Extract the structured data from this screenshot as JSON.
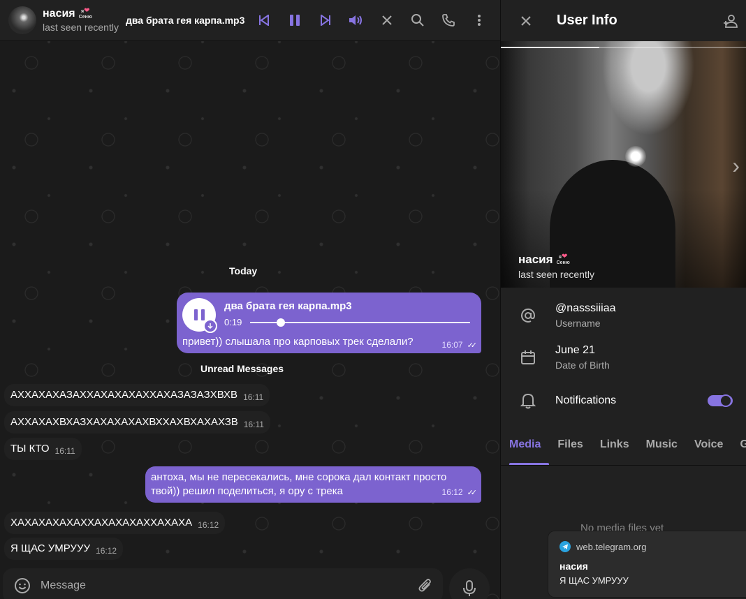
{
  "header": {
    "name": "насия",
    "sticker_line1": "я",
    "sticker_line2": "Сеню",
    "status": "last seen recently",
    "track_title": "два брата гея карпа.mp3"
  },
  "chat": {
    "date_label": "Today",
    "unread_label": "Unread Messages",
    "audio_message": {
      "title": "два брата гея карпа.mp3",
      "duration": "0:19",
      "progress": 0.14,
      "caption": "привет)) слышала про карповых трек сделали?",
      "time": "16:07"
    },
    "messages": [
      {
        "dir": "in",
        "text": "АХХАХАХАЗАХХАХАХАХАХХАХАЗАЗАЗХВХВ",
        "time": "16:11"
      },
      {
        "dir": "in",
        "text": "АХХАХАХВХАЗХАХАХАХАХВХХАХВХАХАХЗВ",
        "time": "16:11"
      },
      {
        "dir": "in",
        "text": "ТЫ КТО",
        "time": "16:11"
      },
      {
        "dir": "out",
        "text_line1": "антоха, мы не пересекались, мне сорока дал контакт просто",
        "text_line2": "твой)) решил поделиться, я ору с трека",
        "time": "16:12"
      },
      {
        "dir": "in",
        "text": "ХАХАХАХАХАХХАХАХАХАХХАХАХА",
        "time": "16:12"
      },
      {
        "dir": "in",
        "text": "Я ЩАС УМРУУУ",
        "time": "16:12"
      }
    ],
    "composer_placeholder": "Message"
  },
  "user_info": {
    "title": "User Info",
    "name": "насия",
    "sticker_line1": "я",
    "sticker_line2": "Сеню",
    "status": "last seen recently",
    "username": "@nasssiiiaa",
    "username_label": "Username",
    "birthday": "June 21",
    "birthday_label": "Date of Birth",
    "notifications_label": "Notifications",
    "notifications_on": true,
    "tabs": [
      "Media",
      "Files",
      "Links",
      "Music",
      "Voice",
      "Gr"
    ],
    "empty_text": "No media files yet"
  },
  "notification": {
    "source": "web.telegram.org",
    "title": "насия",
    "body": "Я ЩАС УМРУУУ"
  },
  "colors": {
    "accent": "#8774e1",
    "outgoing": "#7c63cf",
    "panel": "#212121"
  }
}
